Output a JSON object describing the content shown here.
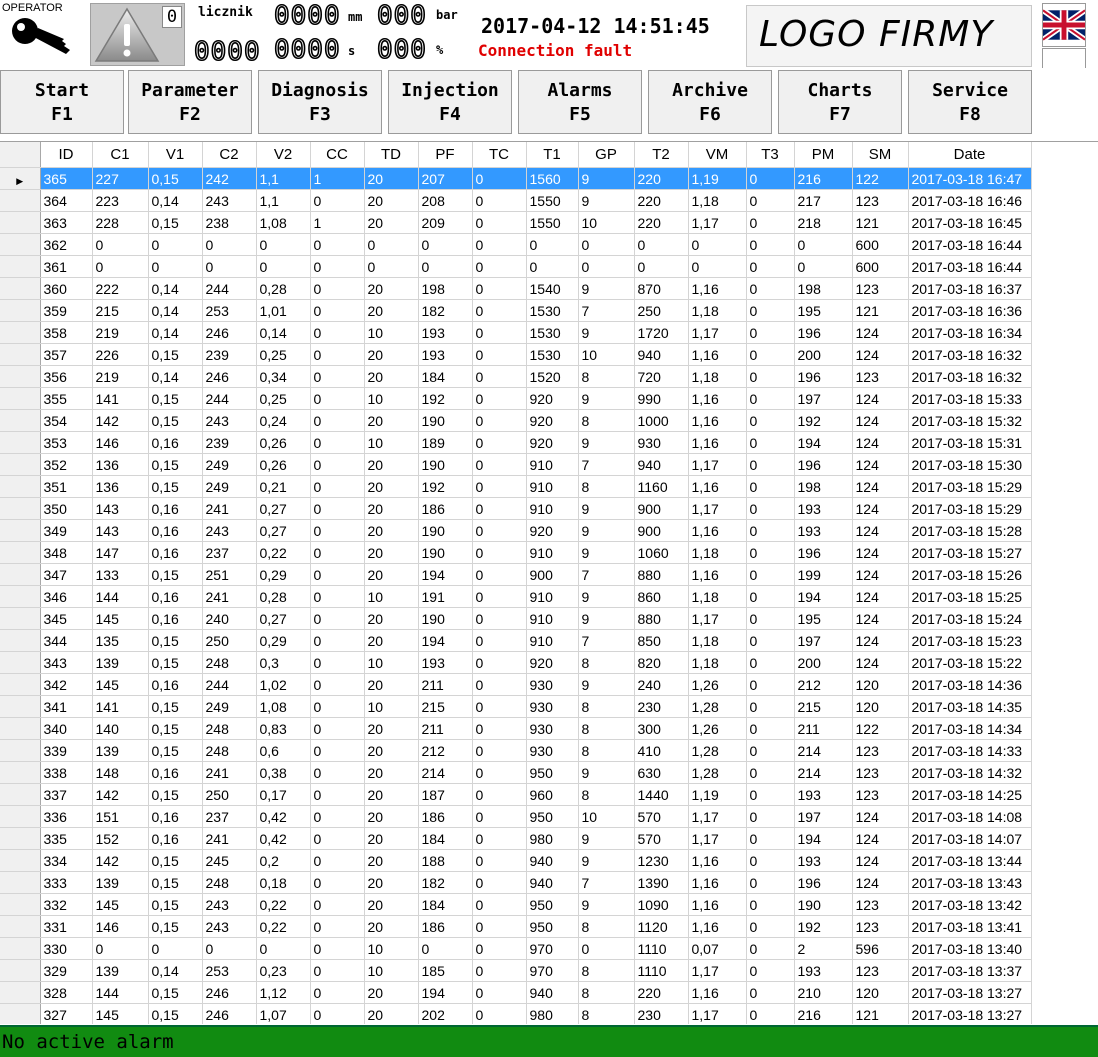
{
  "header": {
    "operator_label": "OPERATOR",
    "warning_count": "0",
    "licznik_label": "licznik",
    "display_1": "0000",
    "unit_1": "mm",
    "display_2": "000",
    "unit_2": "bar",
    "display_3": "0000",
    "display_4": "0000",
    "unit_4": "s",
    "display_5": "000",
    "unit_5": "%",
    "datetime": "2017-04-12 14:51:45",
    "connection_status": "Connection fault",
    "logo": "LOGO FIRMY"
  },
  "languages": [
    "english-flag",
    "polish-flag",
    "romanian-flag"
  ],
  "nav": [
    {
      "label": "Start",
      "key": "F1"
    },
    {
      "label": "Parameter",
      "key": "F2"
    },
    {
      "label": "Diagnosis",
      "key": "F3"
    },
    {
      "label": "Injection",
      "key": "F4"
    },
    {
      "label": "Alarms",
      "key": "F5"
    },
    {
      "label": "Archive",
      "key": "F6"
    },
    {
      "label": "Charts",
      "key": "F7"
    },
    {
      "label": "Service",
      "key": "F8"
    }
  ],
  "table": {
    "columns": [
      "ID",
      "C1",
      "V1",
      "C2",
      "V2",
      "CC",
      "TD",
      "PF",
      "TC",
      "T1",
      "GP",
      "T2",
      "VM",
      "T3",
      "PM",
      "SM",
      "Date"
    ],
    "selected_row": 0,
    "rows": [
      [
        "365",
        "227",
        "0,15",
        "242",
        "1,1",
        "1",
        "20",
        "207",
        "0",
        "1560",
        "9",
        "220",
        "1,19",
        "0",
        "216",
        "122",
        "2017-03-18 16:47"
      ],
      [
        "364",
        "223",
        "0,14",
        "243",
        "1,1",
        "0",
        "20",
        "208",
        "0",
        "1550",
        "9",
        "220",
        "1,18",
        "0",
        "217",
        "123",
        "2017-03-18 16:46"
      ],
      [
        "363",
        "228",
        "0,15",
        "238",
        "1,08",
        "1",
        "20",
        "209",
        "0",
        "1550",
        "10",
        "220",
        "1,17",
        "0",
        "218",
        "121",
        "2017-03-18 16:45"
      ],
      [
        "362",
        "0",
        "0",
        "0",
        "0",
        "0",
        "0",
        "0",
        "0",
        "0",
        "0",
        "0",
        "0",
        "0",
        "0",
        "600",
        "2017-03-18 16:44"
      ],
      [
        "361",
        "0",
        "0",
        "0",
        "0",
        "0",
        "0",
        "0",
        "0",
        "0",
        "0",
        "0",
        "0",
        "0",
        "0",
        "600",
        "2017-03-18 16:44"
      ],
      [
        "360",
        "222",
        "0,14",
        "244",
        "0,28",
        "0",
        "20",
        "198",
        "0",
        "1540",
        "9",
        "870",
        "1,16",
        "0",
        "198",
        "123",
        "2017-03-18 16:37"
      ],
      [
        "359",
        "215",
        "0,14",
        "253",
        "1,01",
        "0",
        "20",
        "182",
        "0",
        "1530",
        "7",
        "250",
        "1,18",
        "0",
        "195",
        "121",
        "2017-03-18 16:36"
      ],
      [
        "358",
        "219",
        "0,14",
        "246",
        "0,14",
        "0",
        "10",
        "193",
        "0",
        "1530",
        "9",
        "1720",
        "1,17",
        "0",
        "196",
        "124",
        "2017-03-18 16:34"
      ],
      [
        "357",
        "226",
        "0,15",
        "239",
        "0,25",
        "0",
        "20",
        "193",
        "0",
        "1530",
        "10",
        "940",
        "1,16",
        "0",
        "200",
        "124",
        "2017-03-18 16:32"
      ],
      [
        "356",
        "219",
        "0,14",
        "246",
        "0,34",
        "0",
        "20",
        "184",
        "0",
        "1520",
        "8",
        "720",
        "1,18",
        "0",
        "196",
        "123",
        "2017-03-18 16:32"
      ],
      [
        "355",
        "141",
        "0,15",
        "244",
        "0,25",
        "0",
        "10",
        "192",
        "0",
        "920",
        "9",
        "990",
        "1,16",
        "0",
        "197",
        "124",
        "2017-03-18 15:33"
      ],
      [
        "354",
        "142",
        "0,15",
        "243",
        "0,24",
        "0",
        "20",
        "190",
        "0",
        "920",
        "8",
        "1000",
        "1,16",
        "0",
        "192",
        "124",
        "2017-03-18 15:32"
      ],
      [
        "353",
        "146",
        "0,16",
        "239",
        "0,26",
        "0",
        "10",
        "189",
        "0",
        "920",
        "9",
        "930",
        "1,16",
        "0",
        "194",
        "124",
        "2017-03-18 15:31"
      ],
      [
        "352",
        "136",
        "0,15",
        "249",
        "0,26",
        "0",
        "20",
        "190",
        "0",
        "910",
        "7",
        "940",
        "1,17",
        "0",
        "196",
        "124",
        "2017-03-18 15:30"
      ],
      [
        "351",
        "136",
        "0,15",
        "249",
        "0,21",
        "0",
        "20",
        "192",
        "0",
        "910",
        "8",
        "1160",
        "1,16",
        "0",
        "198",
        "124",
        "2017-03-18 15:29"
      ],
      [
        "350",
        "143",
        "0,16",
        "241",
        "0,27",
        "0",
        "20",
        "186",
        "0",
        "910",
        "9",
        "900",
        "1,17",
        "0",
        "193",
        "124",
        "2017-03-18 15:29"
      ],
      [
        "349",
        "143",
        "0,16",
        "243",
        "0,27",
        "0",
        "20",
        "190",
        "0",
        "920",
        "9",
        "900",
        "1,16",
        "0",
        "193",
        "124",
        "2017-03-18 15:28"
      ],
      [
        "348",
        "147",
        "0,16",
        "237",
        "0,22",
        "0",
        "20",
        "190",
        "0",
        "910",
        "9",
        "1060",
        "1,18",
        "0",
        "196",
        "124",
        "2017-03-18 15:27"
      ],
      [
        "347",
        "133",
        "0,15",
        "251",
        "0,29",
        "0",
        "20",
        "194",
        "0",
        "900",
        "7",
        "880",
        "1,16",
        "0",
        "199",
        "124",
        "2017-03-18 15:26"
      ],
      [
        "346",
        "144",
        "0,16",
        "241",
        "0,28",
        "0",
        "10",
        "191",
        "0",
        "910",
        "9",
        "860",
        "1,18",
        "0",
        "194",
        "124",
        "2017-03-18 15:25"
      ],
      [
        "345",
        "145",
        "0,16",
        "240",
        "0,27",
        "0",
        "20",
        "190",
        "0",
        "910",
        "9",
        "880",
        "1,17",
        "0",
        "195",
        "124",
        "2017-03-18 15:24"
      ],
      [
        "344",
        "135",
        "0,15",
        "250",
        "0,29",
        "0",
        "20",
        "194",
        "0",
        "910",
        "7",
        "850",
        "1,18",
        "0",
        "197",
        "124",
        "2017-03-18 15:23"
      ],
      [
        "343",
        "139",
        "0,15",
        "248",
        "0,3",
        "0",
        "10",
        "193",
        "0",
        "920",
        "8",
        "820",
        "1,18",
        "0",
        "200",
        "124",
        "2017-03-18 15:22"
      ],
      [
        "342",
        "145",
        "0,16",
        "244",
        "1,02",
        "0",
        "20",
        "211",
        "0",
        "930",
        "9",
        "240",
        "1,26",
        "0",
        "212",
        "120",
        "2017-03-18 14:36"
      ],
      [
        "341",
        "141",
        "0,15",
        "249",
        "1,08",
        "0",
        "10",
        "215",
        "0",
        "930",
        "8",
        "230",
        "1,28",
        "0",
        "215",
        "120",
        "2017-03-18 14:35"
      ],
      [
        "340",
        "140",
        "0,15",
        "248",
        "0,83",
        "0",
        "20",
        "211",
        "0",
        "930",
        "8",
        "300",
        "1,26",
        "0",
        "211",
        "122",
        "2017-03-18 14:34"
      ],
      [
        "339",
        "139",
        "0,15",
        "248",
        "0,6",
        "0",
        "20",
        "212",
        "0",
        "930",
        "8",
        "410",
        "1,28",
        "0",
        "214",
        "123",
        "2017-03-18 14:33"
      ],
      [
        "338",
        "148",
        "0,16",
        "241",
        "0,38",
        "0",
        "20",
        "214",
        "0",
        "950",
        "9",
        "630",
        "1,28",
        "0",
        "214",
        "123",
        "2017-03-18 14:32"
      ],
      [
        "337",
        "142",
        "0,15",
        "250",
        "0,17",
        "0",
        "20",
        "187",
        "0",
        "960",
        "8",
        "1440",
        "1,19",
        "0",
        "193",
        "123",
        "2017-03-18 14:25"
      ],
      [
        "336",
        "151",
        "0,16",
        "237",
        "0,42",
        "0",
        "20",
        "186",
        "0",
        "950",
        "10",
        "570",
        "1,17",
        "0",
        "197",
        "124",
        "2017-03-18 14:08"
      ],
      [
        "335",
        "152",
        "0,16",
        "241",
        "0,42",
        "0",
        "20",
        "184",
        "0",
        "980",
        "9",
        "570",
        "1,17",
        "0",
        "194",
        "124",
        "2017-03-18 14:07"
      ],
      [
        "334",
        "142",
        "0,15",
        "245",
        "0,2",
        "0",
        "20",
        "188",
        "0",
        "940",
        "9",
        "1230",
        "1,16",
        "0",
        "193",
        "124",
        "2017-03-18 13:44"
      ],
      [
        "333",
        "139",
        "0,15",
        "248",
        "0,18",
        "0",
        "20",
        "182",
        "0",
        "940",
        "7",
        "1390",
        "1,16",
        "0",
        "196",
        "124",
        "2017-03-18 13:43"
      ],
      [
        "332",
        "145",
        "0,15",
        "243",
        "0,22",
        "0",
        "20",
        "184",
        "0",
        "950",
        "9",
        "1090",
        "1,16",
        "0",
        "190",
        "123",
        "2017-03-18 13:42"
      ],
      [
        "331",
        "146",
        "0,15",
        "243",
        "0,22",
        "0",
        "20",
        "186",
        "0",
        "950",
        "8",
        "1120",
        "1,16",
        "0",
        "192",
        "123",
        "2017-03-18 13:41"
      ],
      [
        "330",
        "0",
        "0",
        "0",
        "0",
        "0",
        "10",
        "0",
        "0",
        "970",
        "0",
        "1110",
        "0,07",
        "0",
        "2",
        "596",
        "2017-03-18 13:40"
      ],
      [
        "329",
        "139",
        "0,14",
        "253",
        "0,23",
        "0",
        "10",
        "185",
        "0",
        "970",
        "8",
        "1110",
        "1,17",
        "0",
        "193",
        "123",
        "2017-03-18 13:37"
      ],
      [
        "328",
        "144",
        "0,15",
        "246",
        "1,12",
        "0",
        "20",
        "194",
        "0",
        "940",
        "8",
        "220",
        "1,16",
        "0",
        "210",
        "120",
        "2017-03-18 13:27"
      ],
      [
        "327",
        "145",
        "0,15",
        "246",
        "1,07",
        "0",
        "20",
        "202",
        "0",
        "980",
        "8",
        "230",
        "1,17",
        "0",
        "216",
        "121",
        "2017-03-18 13:27"
      ]
    ]
  },
  "status": {
    "text": "No active alarm",
    "color": "#118b11"
  }
}
